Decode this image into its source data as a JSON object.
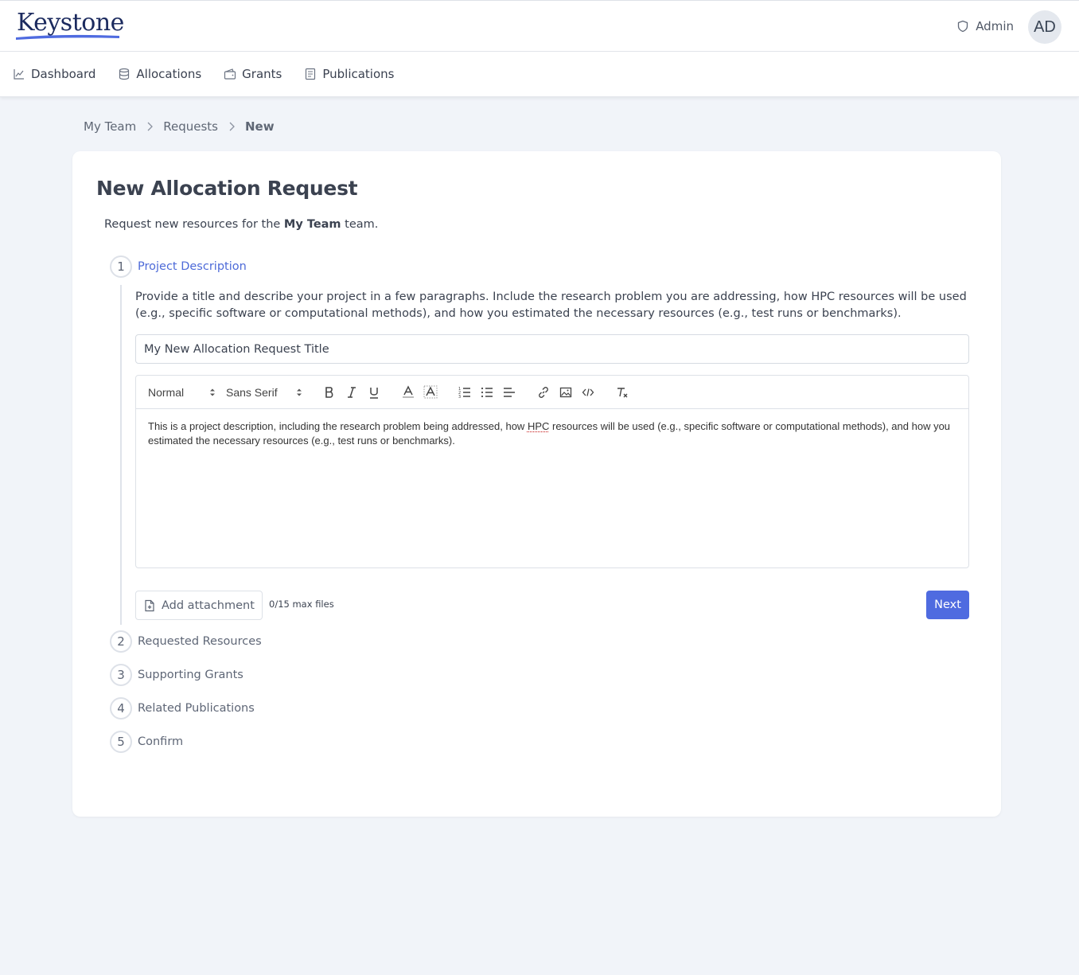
{
  "app": {
    "logo_text": "Keystone",
    "user_role": "Admin",
    "user_initials": "AD"
  },
  "nav": {
    "items": [
      {
        "label": "Dashboard",
        "icon": "chart-line-icon"
      },
      {
        "label": "Allocations",
        "icon": "database-icon"
      },
      {
        "label": "Grants",
        "icon": "wallet-icon"
      },
      {
        "label": "Publications",
        "icon": "document-icon"
      }
    ]
  },
  "breadcrumb": {
    "items": [
      "My Team",
      "Requests"
    ],
    "current": "New"
  },
  "page": {
    "title": "New Allocation Request",
    "subtitle_prefix": "Request new resources for the ",
    "subtitle_team": "My Team",
    "subtitle_suffix": " team."
  },
  "steps": [
    {
      "number": "1",
      "label": "Project Description",
      "active": true
    },
    {
      "number": "2",
      "label": "Requested Resources",
      "active": false
    },
    {
      "number": "3",
      "label": "Supporting Grants",
      "active": false
    },
    {
      "number": "4",
      "label": "Related Publications",
      "active": false
    },
    {
      "number": "5",
      "label": "Confirm",
      "active": false
    }
  ],
  "step1": {
    "description": "Provide a title and describe your project in a few paragraphs. Include the research problem you are addressing, how HPC resources will be used (e.g., specific software or computational methods), and how you estimated the necessary resources (e.g., test runs or benchmarks).",
    "title_value": "My New Allocation Request Title",
    "editor": {
      "format_select": "Normal",
      "font_select": "Sans Serif",
      "text_before": "This is a project description, including the research problem being addressed, how ",
      "text_spell": "HPC",
      "text_after": " resources will be used (e.g., specific software or computational methods), and how you estimated the necessary resources (e.g., test runs or benchmarks)."
    },
    "attach_label": "Add attachment",
    "max_files": "0/15 max files",
    "next_label": "Next"
  },
  "colors": {
    "accent": "#4f6be0",
    "active_step": "#4d6ad8",
    "background": "#f1f4f9"
  }
}
